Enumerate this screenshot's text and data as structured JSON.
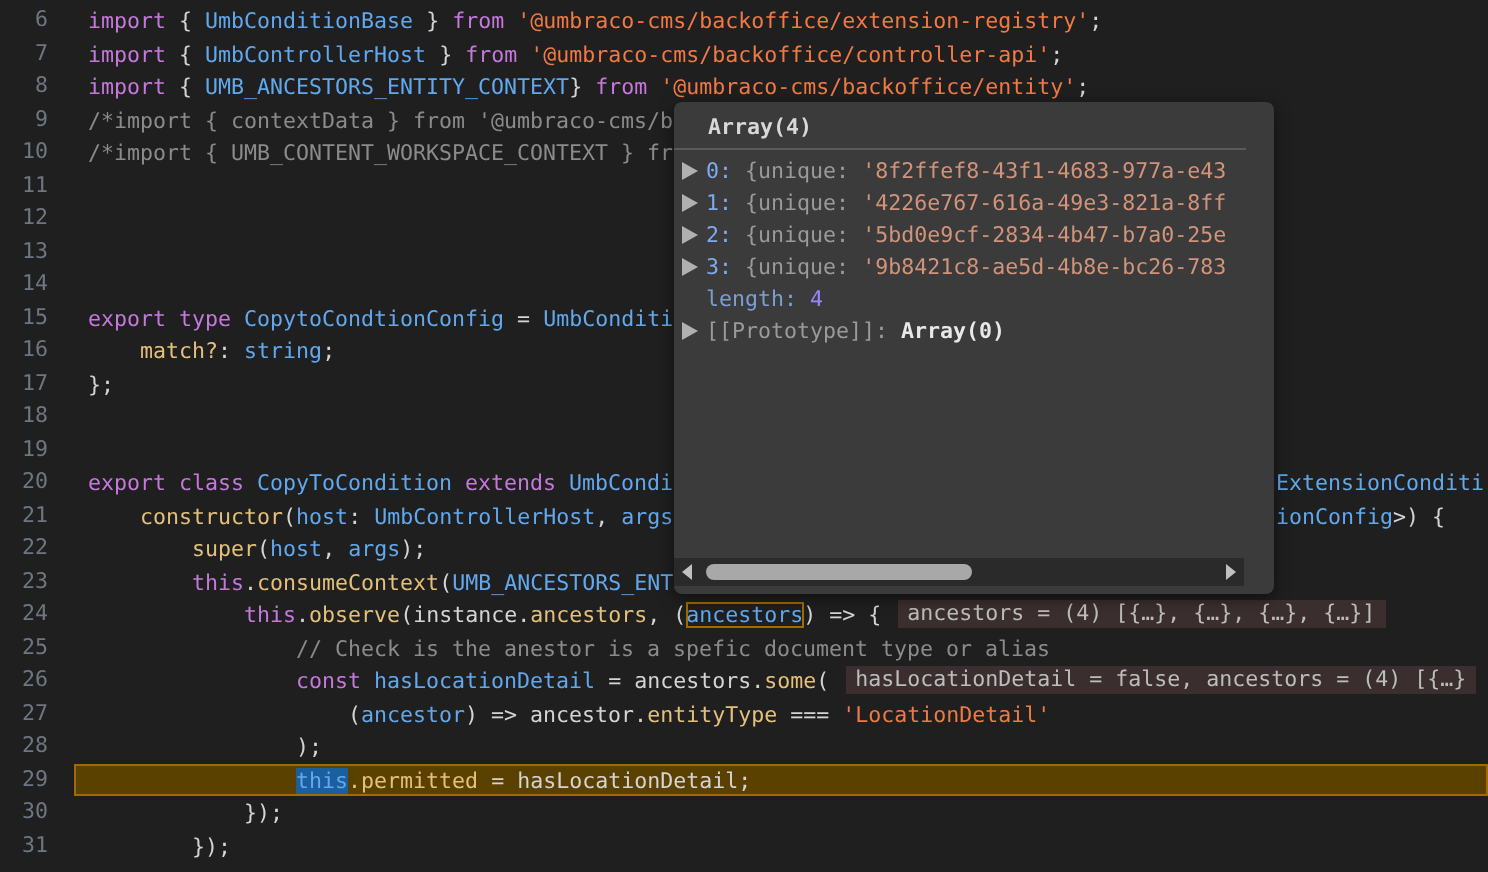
{
  "lines": [
    {
      "number": "6",
      "highlighted": false,
      "tokens": [
        {
          "text": "import",
          "kind": "keyword"
        },
        {
          "text": " { ",
          "kind": "plain"
        },
        {
          "text": "UmbConditionBase",
          "kind": "type"
        },
        {
          "text": " } ",
          "kind": "plain"
        },
        {
          "text": "from ",
          "kind": "keyword"
        },
        {
          "text": "'@umbraco-cms/backoffice/extension-registry'",
          "kind": "string"
        },
        {
          "text": ";",
          "kind": "plain"
        }
      ]
    },
    {
      "number": "7",
      "highlighted": false,
      "tokens": [
        {
          "text": "import",
          "kind": "keyword"
        },
        {
          "text": " { ",
          "kind": "plain"
        },
        {
          "text": "UmbControllerHost",
          "kind": "type"
        },
        {
          "text": " } ",
          "kind": "plain"
        },
        {
          "text": "from ",
          "kind": "keyword"
        },
        {
          "text": "'@umbraco-cms/backoffice/controller-api'",
          "kind": "string"
        },
        {
          "text": ";",
          "kind": "plain"
        }
      ]
    },
    {
      "number": "8",
      "highlighted": false,
      "tokens": [
        {
          "text": "import",
          "kind": "keyword"
        },
        {
          "text": " { ",
          "kind": "plain"
        },
        {
          "text": "UMB_ANCESTORS_ENTITY_CONTEXT",
          "kind": "type"
        },
        {
          "text": "} ",
          "kind": "plain"
        },
        {
          "text": "from ",
          "kind": "keyword"
        },
        {
          "text": "'@umbraco-cms/backoffice/entity'",
          "kind": "string"
        },
        {
          "text": ";",
          "kind": "plain"
        }
      ]
    },
    {
      "number": "9",
      "highlighted": false,
      "tokens": [
        {
          "text": "/*import { contextData } from '@umbraco-cms/b",
          "kind": "comment"
        }
      ]
    },
    {
      "number": "10",
      "highlighted": false,
      "tokens": [
        {
          "text": "/*import { UMB_CONTENT_WORKSPACE_CONTEXT } fr",
          "kind": "comment"
        }
      ]
    },
    {
      "number": "11",
      "highlighted": false
    },
    {
      "number": "12",
      "highlighted": false
    },
    {
      "number": "13",
      "highlighted": false
    },
    {
      "number": "14",
      "highlighted": false
    },
    {
      "number": "15",
      "highlighted": false,
      "tokens": [
        {
          "text": "export type ",
          "kind": "keyword"
        },
        {
          "text": "CopytoCondtionConfig",
          "kind": "type"
        },
        {
          "text": " = ",
          "kind": "plain"
        },
        {
          "text": "UmbConditi",
          "kind": "type"
        }
      ]
    },
    {
      "number": "16",
      "highlighted": false,
      "tokens": [
        {
          "text": "    match?",
          "kind": "member"
        },
        {
          "text": ": ",
          "kind": "plain"
        },
        {
          "text": "string",
          "kind": "type"
        },
        {
          "text": ";",
          "kind": "plain"
        }
      ]
    },
    {
      "number": "17",
      "highlighted": false,
      "tokens": [
        {
          "text": "};",
          "kind": "plain"
        }
      ]
    },
    {
      "number": "18",
      "highlighted": false
    },
    {
      "number": "19",
      "highlighted": false
    },
    {
      "number": "20",
      "highlighted": false,
      "tokens": [
        {
          "text": "export class ",
          "kind": "keyword"
        },
        {
          "text": "CopyToCondition ",
          "kind": "type"
        },
        {
          "text": "extends ",
          "kind": "keyword"
        },
        {
          "text": "UmbCondi",
          "kind": "type"
        }
      ],
      "right": [
        {
          "text": "ExtensionConditi",
          "kind": "type"
        }
      ]
    },
    {
      "number": "21",
      "highlighted": false,
      "tokens": [
        {
          "text": "    constructor",
          "kind": "member"
        },
        {
          "text": "(",
          "kind": "plain"
        },
        {
          "text": "host",
          "kind": "type"
        },
        {
          "text": ": ",
          "kind": "plain"
        },
        {
          "text": "UmbControllerHost",
          "kind": "type"
        },
        {
          "text": ", ",
          "kind": "plain"
        },
        {
          "text": "args",
          "kind": "type"
        }
      ],
      "right": [
        {
          "text": "ionConfig",
          "kind": "type"
        },
        {
          "text": ">) {",
          "kind": "plain"
        }
      ]
    },
    {
      "number": "22",
      "highlighted": false,
      "tokens": [
        {
          "text": "        super",
          "kind": "member"
        },
        {
          "text": "(",
          "kind": "plain"
        },
        {
          "text": "host",
          "kind": "type"
        },
        {
          "text": ", ",
          "kind": "plain"
        },
        {
          "text": "args",
          "kind": "type"
        },
        {
          "text": ");",
          "kind": "plain"
        }
      ]
    },
    {
      "number": "23",
      "highlighted": false,
      "tokens": [
        {
          "text": "        this",
          "kind": "keyword"
        },
        {
          "text": ".",
          "kind": "plain"
        },
        {
          "text": "consumeContext",
          "kind": "member"
        },
        {
          "text": "(",
          "kind": "plain"
        },
        {
          "text": "UMB_ANCESTORS_ENT",
          "kind": "type"
        }
      ]
    },
    {
      "number": "24",
      "highlighted": false,
      "tokens": [
        {
          "text": "            this",
          "kind": "keyword"
        },
        {
          "text": ".",
          "kind": "plain"
        },
        {
          "text": "observe",
          "kind": "member"
        },
        {
          "text": "(instance.",
          "kind": "plain"
        },
        {
          "text": "ancestors",
          "kind": "member"
        },
        {
          "text": ", (",
          "kind": "plain"
        },
        {
          "text": "ancestors",
          "kind": "bracket"
        },
        {
          "text": ") => {",
          "kind": "plain"
        }
      ],
      "hint": "ancestors = (4) [{…}, {…}, {…}, {…}]"
    },
    {
      "number": "25",
      "highlighted": false,
      "tokens": [
        {
          "text": "                // Check is the anestor is a spefic document type or alias",
          "kind": "comment"
        }
      ]
    },
    {
      "number": "26",
      "highlighted": false,
      "tokens": [
        {
          "text": "                const ",
          "kind": "keyword"
        },
        {
          "text": "hasLocationDetail",
          "kind": "type"
        },
        {
          "text": " = ancestors.",
          "kind": "plain"
        },
        {
          "text": "some",
          "kind": "member"
        },
        {
          "text": "(",
          "kind": "plain"
        }
      ],
      "hint": "hasLocationDetail = false, ancestors = (4) [{…}"
    },
    {
      "number": "27",
      "highlighted": false,
      "tokens": [
        {
          "text": "                    (",
          "kind": "plain"
        },
        {
          "text": "ancestor",
          "kind": "type"
        },
        {
          "text": ") => ancestor.",
          "kind": "plain"
        },
        {
          "text": "entityType",
          "kind": "member"
        },
        {
          "text": " === ",
          "kind": "plain"
        },
        {
          "text": "'LocationDetail'",
          "kind": "string"
        }
      ]
    },
    {
      "number": "28",
      "highlighted": false,
      "tokens": [
        {
          "text": "                );",
          "kind": "plain"
        }
      ]
    },
    {
      "number": "29",
      "highlighted": true,
      "tokens": [
        {
          "text": "                this",
          "kind": "selection"
        },
        {
          "text": ".permitted",
          "kind": "member"
        },
        {
          "text": " = hasLocationDetail;",
          "kind": "plain"
        }
      ]
    },
    {
      "number": "30",
      "highlighted": false,
      "tokens": [
        {
          "text": "            });",
          "kind": "plain"
        }
      ]
    },
    {
      "number": "31",
      "highlighted": false,
      "tokens": [
        {
          "text": "        });",
          "kind": "plain"
        }
      ]
    }
  ],
  "popup": {
    "title": "Array(4)",
    "items": [
      {
        "index": "0:",
        "key": "{unique:",
        "value": "'8f2ffef8-43f1-4683-977a-e43",
        "expanded": false
      },
      {
        "index": "1:",
        "key": "{unique:",
        "value": "'4226e767-616a-49e3-821a-8ff",
        "expanded": false
      },
      {
        "index": "2:",
        "key": "{unique:",
        "value": "'5bd0e9cf-2834-4b47-b7a0-25e",
        "expanded": false
      },
      {
        "index": "3:",
        "key": "{unique:",
        "value": "'9b8421c8-ae5d-4b8e-bc26-783",
        "expanded": false
      }
    ],
    "length": {
      "key": "length:",
      "value": "4"
    },
    "prototype": {
      "key": "[[Prototype]]:",
      "value": "Array(0)",
      "expanded": false
    }
  }
}
